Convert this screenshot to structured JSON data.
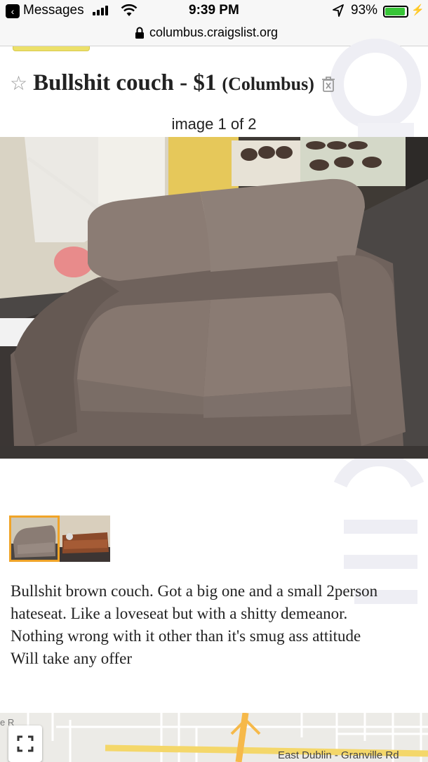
{
  "status_bar": {
    "back_app": "Messages",
    "time": "9:39 PM",
    "battery": "93%",
    "battery_level": 0.93,
    "back_icon": "chevron-left-icon",
    "signal_icon": "cellular-signal-icon",
    "wifi_icon": "wifi-icon",
    "location_icon": "location-arrow-icon",
    "charging_icon": "charging-bolt-icon"
  },
  "url_bar": {
    "lock_icon": "lock-icon",
    "url": "columbus.craigslist.org"
  },
  "posting": {
    "favorite_icon": "star-outline-icon",
    "favorite_glyph": "☆",
    "title": "Bullshit couch - $1",
    "location": "(Columbus)",
    "hide_icon": "trash-icon",
    "image_counter": "image 1 of 2",
    "body": [
      "Bullshit brown couch. Got a big one and a small 2person hateseat. Like a loveseat but with a shitty demeanor.",
      "Nothing wrong with it other than it's smug ass attitude",
      "Will take any offer"
    ]
  },
  "thumbnails": [
    {
      "alt": "gray loveseat",
      "selected": true
    },
    {
      "alt": "brown couch",
      "selected": false
    }
  ],
  "map": {
    "road_label": "East Dublin - Granville Rd",
    "edge_label": "e R",
    "fullscreen_icon": "fullscreen-icon"
  },
  "colors": {
    "accent_selected": "#f0a428",
    "yellow_tab": "#ece06a",
    "battery_green": "#37c537"
  }
}
